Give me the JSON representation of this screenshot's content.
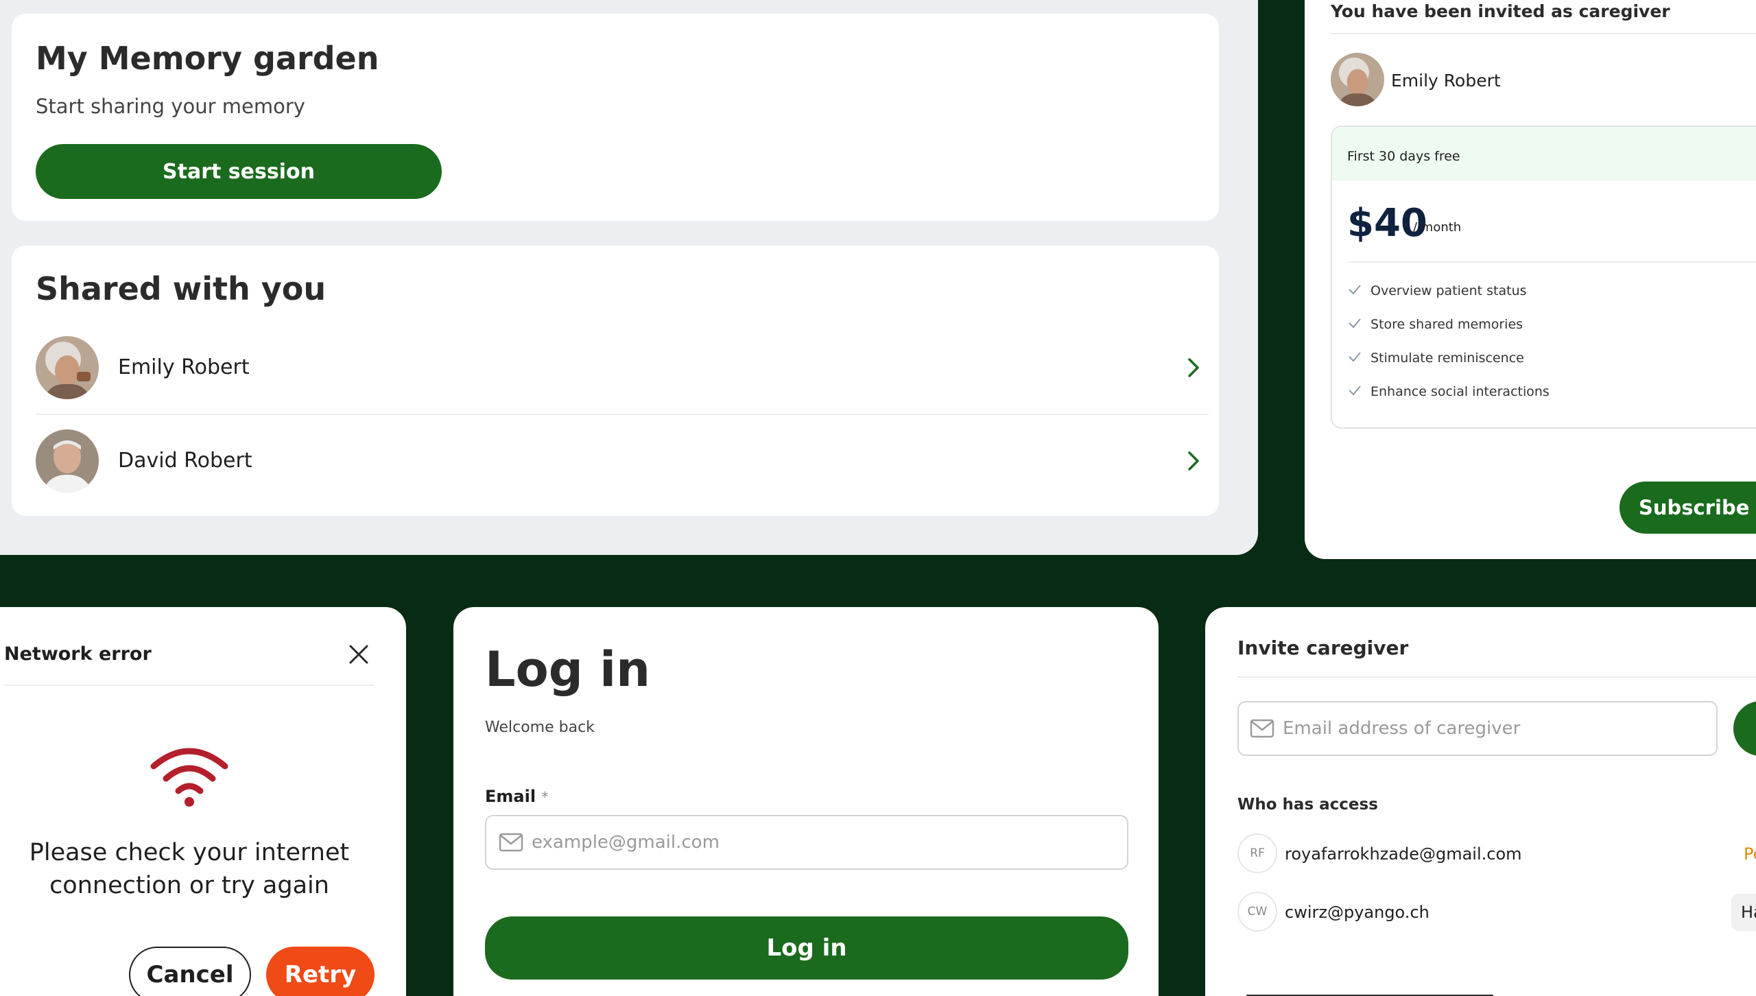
{
  "memory": {
    "title": "My Memory garden",
    "subtitle": "Start sharing your memory",
    "start_label": "Start session"
  },
  "shared": {
    "title": "Shared with you",
    "people": [
      {
        "name": "Emily Robert",
        "avatar": "elderly-woman-avatar"
      },
      {
        "name": "David Robert",
        "avatar": "elderly-man-avatar"
      }
    ]
  },
  "invite_offer": {
    "heading": "You have been invited as caregiver",
    "person": "Emily Robert",
    "trial": "First 30 days free",
    "price": "$40",
    "period": "/ month",
    "features": [
      "Overview patient status",
      "Store shared memories",
      "Stimulate reminiscence",
      "Enhance social interactions"
    ],
    "subscribe_label": "Subscribe fo"
  },
  "network_error": {
    "title": "Network error",
    "message_line1": "Please check your internet",
    "message_line2": "connection or try again",
    "cancel_label": "Cancel",
    "retry_label": "Retry"
  },
  "login": {
    "title": "Log in",
    "subtitle": "Welcome back",
    "email_label": "Email",
    "required_mark": "*",
    "email_placeholder": "example@gmail.com",
    "submit_label": "Log in"
  },
  "invite_caregiver": {
    "title": "Invite caregiver",
    "email_placeholder": "Email address of caregiver",
    "access_title": "Who has access",
    "members": [
      {
        "initials": "RF",
        "email": "royafarrokhzade@gmail.com",
        "status": "Pe"
      },
      {
        "initials": "CW",
        "email": "cwirz@pyango.ch",
        "status": "Has ac"
      }
    ]
  },
  "colors": {
    "brand_green": "#1a6b1d",
    "dark_background": "#082b13",
    "error_red": "#b3202c",
    "retry_orange": "#f04a16",
    "pending_orange": "#e08a00"
  },
  "icons": [
    "chevron-right-icon",
    "close-icon",
    "wifi-icon",
    "mail-icon",
    "check-icon"
  ]
}
